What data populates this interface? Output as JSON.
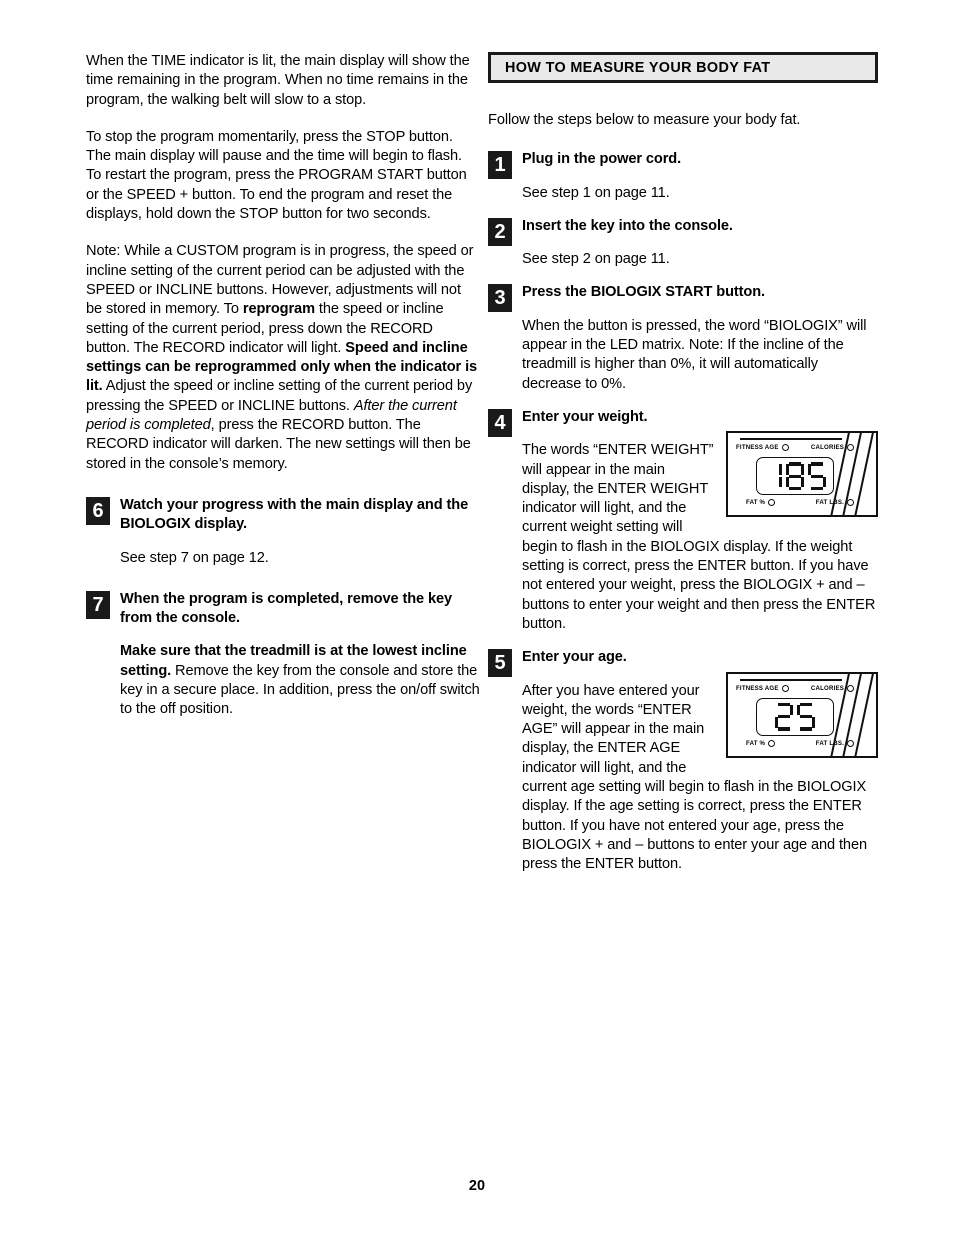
{
  "page": {
    "number": "20"
  },
  "left_column": {
    "paragraphs": [
      "When the TIME indicator is lit, the main display will show the time remaining in the program. When no time remains in the program, the walking belt will slow to a stop.",
      "To stop the program momentarily, press the STOP button. The main display will pause and the time will begin to flash. To restart the program, press the PROGRAM START button or the SPEED + button. To end the program and reset the displays, hold down the STOP button for two seconds."
    ],
    "note": {
      "part1": "Note: While a CUSTOM program is in progress, the speed or incline setting of the current period can be adjusted with the SPEED or INCLINE buttons. However, adjustments will not be stored in memory. To ",
      "bold1": "reprogram",
      "part2": " the speed or incline setting of the current period, press down the RECORD button. The RECORD indicator will light. ",
      "bold2": "Speed and incline settings can be reprogrammed only when the indicator is lit.",
      "part3": " Adjust the speed or incline setting of the current period by pressing the SPEED or INCLINE buttons. ",
      "italic1": "After the current period is completed",
      "part4": ", press the RECORD button. The RECORD indicator will darken. The new settings will then be stored in the console’s memory."
    },
    "steps": [
      {
        "number": "6",
        "title": "Watch your progress with the main display and the BIOLOGIX display.",
        "body": "See step 7 on page 12."
      },
      {
        "number": "7",
        "title": "When the program is completed, remove the key from the console.",
        "body_bold": "Make sure that the treadmill is at the lowest incline setting.",
        "body_rest": " Remove the key from the console and store the key in a secure place. In addition, press the on/off switch to the off position."
      }
    ]
  },
  "right_column": {
    "header": "HOW TO MEASURE YOUR BODY FAT",
    "intro": "Follow the steps below to measure your body fat.",
    "steps": [
      {
        "number": "1",
        "title": "Plug in the power cord.",
        "body": "See step 1 on page 11."
      },
      {
        "number": "2",
        "title": "Insert the key into the console.",
        "body": "See step 2 on page 11."
      },
      {
        "number": "3",
        "title": "Press the BIOLOGIX START button.",
        "body": "When the button is pressed, the word “BIOLOGIX” will appear in the LED matrix. Note: If the incline of the treadmill is higher than 0%, it will automatically decrease to 0%."
      },
      {
        "number": "4",
        "title": "Enter your weight.",
        "body": "The words “ENTER WEIGHT” will appear in the main display, the ENTER WEIGHT indicator will light, and the current weight setting will begin to flash in the BIOLOGIX display. If the weight setting is correct, press the ENTER button. If you have not entered your weight, press the BIOLOGIX + and – buttons to enter your weight and then press the ENTER button."
      },
      {
        "number": "5",
        "title": "Enter your age.",
        "body": "After you have entered your weight, the words “ENTER AGE” will appear in the main display, the ENTER AGE indicator will light, and the current age setting will begin to flash in the BIOLOGIX display. If the age setting is correct, press the ENTER button. If you have not entered your age, press the BIOLOGIX + and – buttons to enter your age and then press the ENTER button."
      }
    ],
    "figures": [
      {
        "name": "biologix-display-weight",
        "label_fitness_age": "FITNESS AGE",
        "label_calories": "CALORIES",
        "label_fat_pct": "FAT %",
        "label_fat_lbs": "FAT LBS.",
        "value": "185"
      },
      {
        "name": "biologix-display-age",
        "label_fitness_age": "FITNESS AGE",
        "label_calories": "CALORIES",
        "label_fat_pct": "FAT %",
        "label_fat_lbs": "FAT LBS.",
        "value": "25"
      }
    ]
  }
}
